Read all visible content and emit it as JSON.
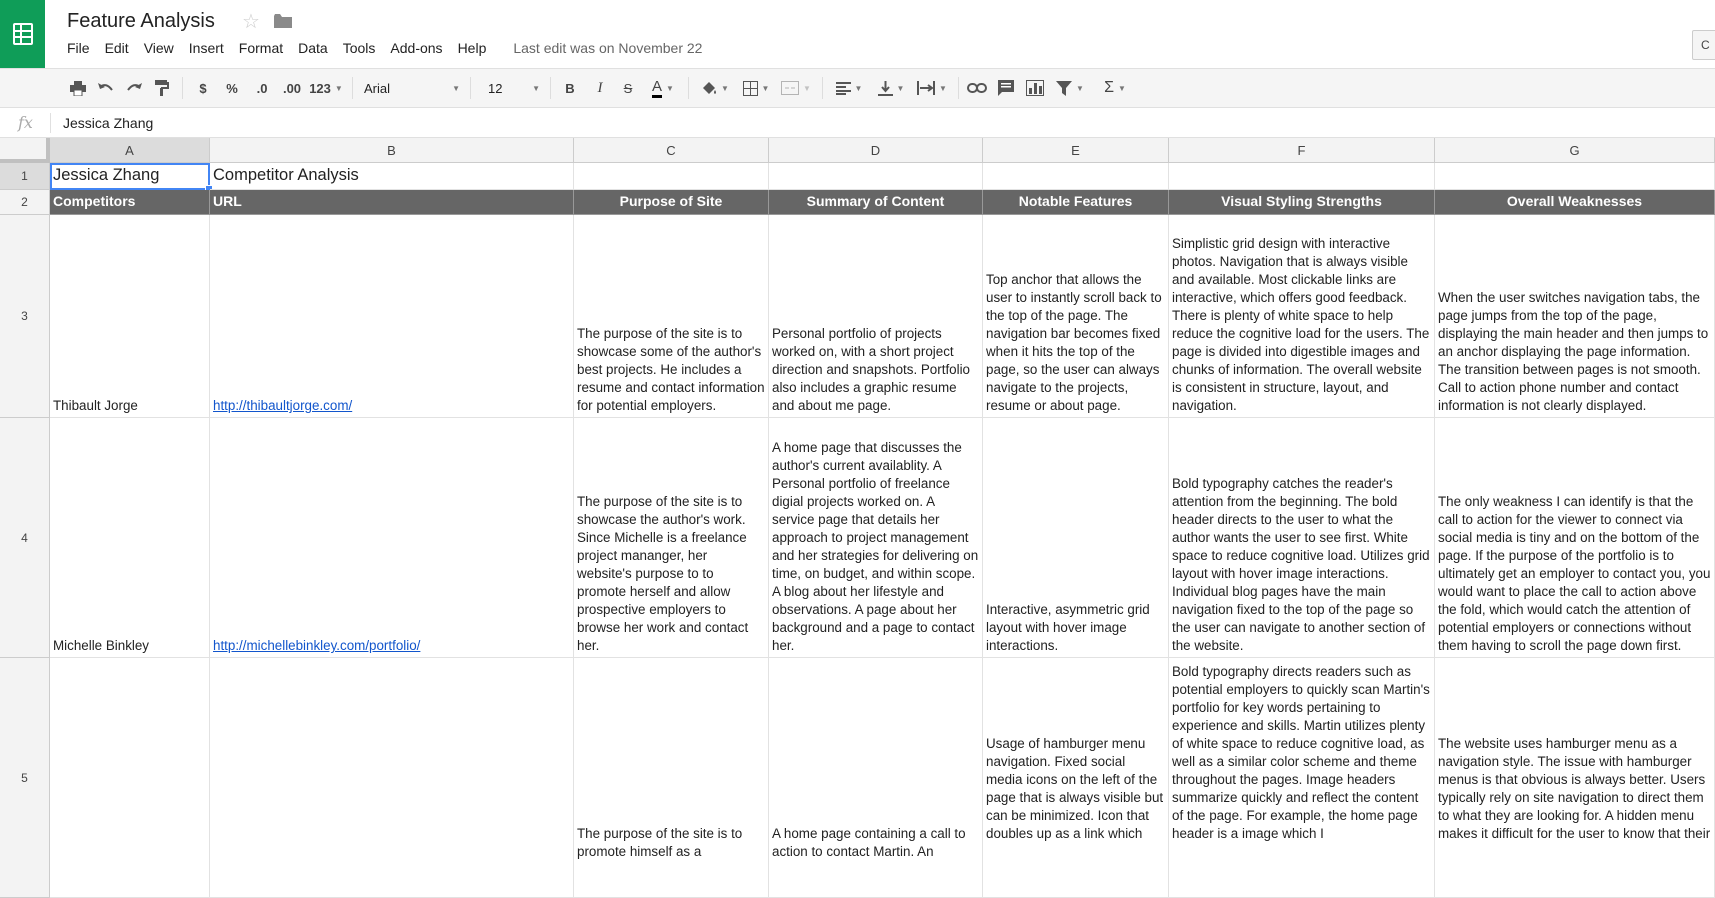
{
  "app": {
    "title": "Feature Analysis",
    "last_edit": "Last edit was on November 22",
    "comment_label": "C",
    "menu": [
      "File",
      "Edit",
      "View",
      "Insert",
      "Format",
      "Data",
      "Tools",
      "Add-ons",
      "Help"
    ]
  },
  "toolbar": {
    "currency": "$",
    "percent": "%",
    "dec_decrease": ".0",
    "dec_increase": ".00",
    "more_formats": "123",
    "font": "Arial",
    "font_size": "12",
    "bold": "B",
    "italic": "I",
    "strike": "S",
    "text_color": "A",
    "function": "Σ"
  },
  "formula_bar": {
    "fx": "fx",
    "value": "Jessica Zhang"
  },
  "columns": [
    "A",
    "B",
    "C",
    "D",
    "E",
    "F",
    "G"
  ],
  "rows": [
    "1",
    "2",
    "3",
    "4",
    "5"
  ],
  "cells": {
    "r1": {
      "a": "Jessica Zhang",
      "b": "Competitor Analysis"
    },
    "r2": {
      "a": "Competitors",
      "b": "URL",
      "c": "Purpose of Site",
      "d": "Summary of Content",
      "e": "Notable Features",
      "f": "Visual Styling Strengths",
      "g": "Overall Weaknesses"
    },
    "r3": {
      "a": "Thibault Jorge",
      "b": "http://thibaultjorge.com/",
      "c": "The purpose of the site is to showcase some of the author's best projects. He includes a resume and contact information for potential employers.",
      "d": "Personal portfolio of projects worked on, with a short project direction and snapshots. Portfolio also includes a graphic resume and about me page.",
      "e": "Top anchor that allows the user to instantly scroll back to the top of the page. The navigation bar becomes fixed when it hits the top of the page, so the user can always navigate to the projects, resume or about page.",
      "f": "Simplistic grid design with interactive photos. Navigation that is always visible and available. Most clickable links are interactive, which offers good feedback. There is plenty of white space to help reduce the cognitive load for the users. The page is divided into digestible images and chunks of information. The overall website is consistent in structure, layout, and navigation.",
      "g": "When the user switches navigation tabs, the page jumps from the top of the page, displaying the main header and then jumps to an anchor displaying the page information. The transition between pages is not smooth. Call to action phone number and contact information is not clearly displayed."
    },
    "r4": {
      "a": "Michelle Binkley",
      "b": "http://michellebinkley.com/portfolio/",
      "c": "The purpose of the site is to showcase the author's work. Since Michelle is a freelance project mananger, her website's purpose to to promote herself and allow prospective employers to browse her work and contact her.",
      "d": "A home page that discusses the author's current availablity. A Personal portfolio of freelance digial projects worked on. A service page that details her approach to project management and her strategies for delivering on time, on budget, and within scope. A blog about her lifestyle and observations. A page about her background and a page to contact her.",
      "e": "Interactive, asymmetric grid layout with hover image interactions.",
      "f": "Bold typography catches the reader's attention from the beginning. The bold header directs to the user to what the author wants the user to see first. White space to reduce cognitive load. Utilizes grid layout with hover image interactions. Individual blog pages have the main navigation fixed to the top of the page so the user can navigate to another section of the website.",
      "g": "The only weakness I can identify is that the call to action for the viewer to connect via social media is tiny and on the bottom of the page. If the purpose of the portfolio is to ultimately get an employer to contact you, you would want to place the call to action above the fold, which would catch the attention of potential employers or connections without them having to scroll the page down first."
    },
    "r5": {
      "c": "The purpose of the site is to promote himself as a",
      "d": "A home page containing a call to action to contact Martin.  An",
      "e": "Usage of hamburger menu navigation. Fixed social media icons on the left of the page that is always visible but can be minimized. Icon that doubles up as a link which",
      "f": "Bold typography directs readers such as potential employers to quickly scan Martin's portfolio for key words pertaining to experience and skills. Martin utilizes plenty of white space to reduce cognitive load, as well as a similar color scheme and theme throughout the pages. Image headers summarize quickly and reflect the content of the page. For example, the home page header is a image which I",
      "g": "The website uses hamburger menu as a navigation style. The issue with hamburger menus is that obvious is always better. Users typically rely on site navigation to direct them to what they are looking for. A hidden menu makes it difficult for the user to know that their"
    }
  },
  "colors": {
    "brand": "#0f9d58",
    "header_row_bg": "#666666",
    "link": "#1155cc",
    "selection": "#4285f4"
  }
}
